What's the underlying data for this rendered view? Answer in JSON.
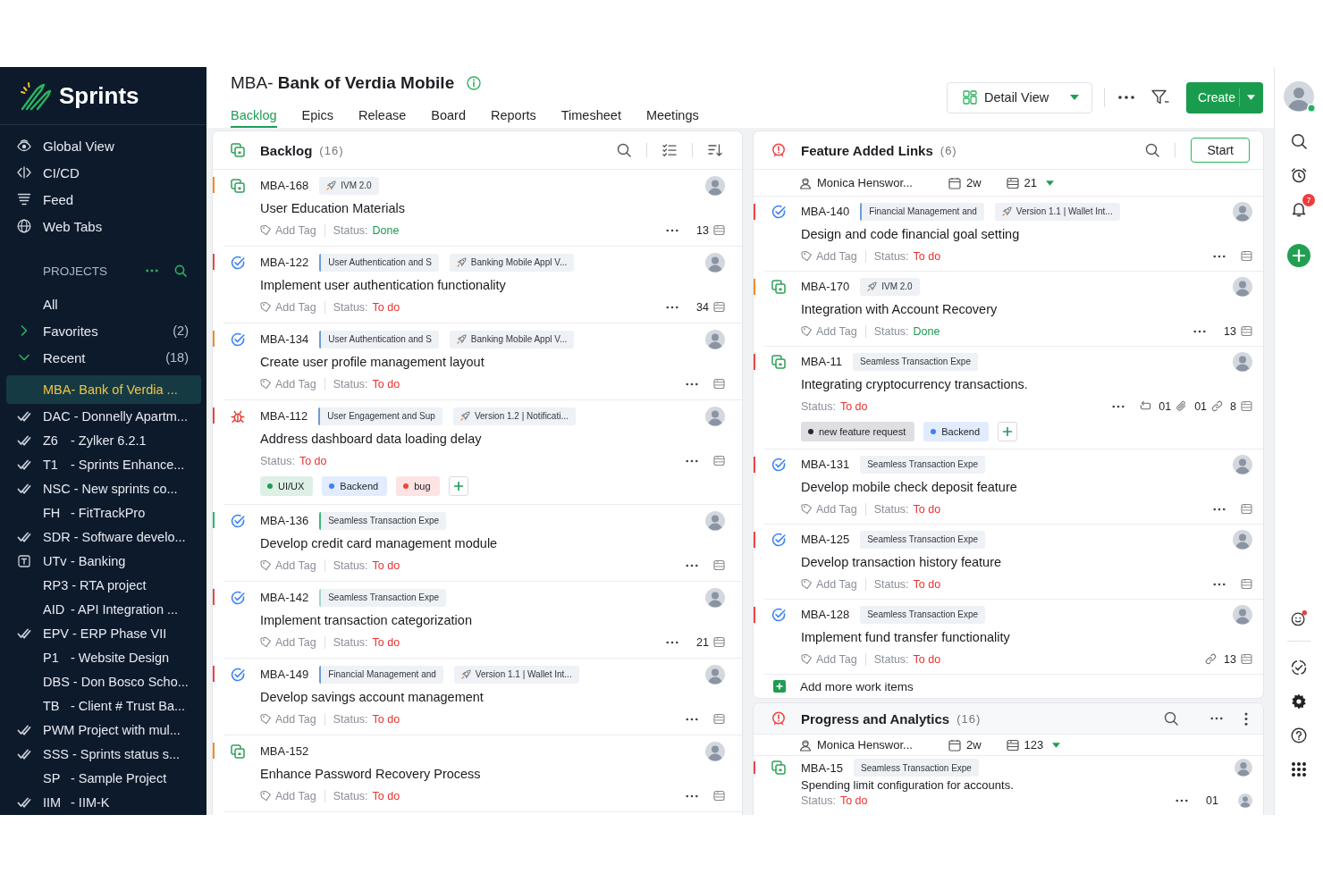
{
  "sidebar": {
    "logo": "Sprints",
    "nav": [
      {
        "label": "Global View"
      },
      {
        "label": "CI/CD"
      },
      {
        "label": "Feed"
      },
      {
        "label": "Web Tabs"
      }
    ],
    "projects": {
      "heading": "PROJECTS",
      "all": "All",
      "groups": [
        {
          "label": "Favorites",
          "count": "(2)",
          "expanded": false
        },
        {
          "label": "Recent",
          "count": "(18)",
          "expanded": true,
          "children": [
            {
              "name": "MBA- Bank of Verdia ...",
              "kind": "plain",
              "selected": true
            },
            {
              "code": "DAC",
              "name": "- Donnelly Apartm...",
              "kind": "check",
              "selected": false
            },
            {
              "code": "Z6",
              "name": "- Zylker 6.2.1",
              "kind": "check",
              "selected": false
            },
            {
              "code": "T1",
              "name": "- Sprints Enhance...",
              "kind": "check",
              "selected": false
            },
            {
              "code": "NSC",
              "name": "- New sprints co...",
              "kind": "check",
              "selected": false
            },
            {
              "code": "FH",
              "name": "- FitTrackPro",
              "kind": "plain",
              "selected": false
            },
            {
              "code": "SDR",
              "name": "- Software develo...",
              "kind": "check",
              "selected": false
            },
            {
              "code": "UTv",
              "name": "- Banking",
              "kind": "text",
              "selected": false
            },
            {
              "code": "RP3",
              "name": "- RTA project",
              "kind": "plain",
              "selected": false
            },
            {
              "code": "AID",
              "name": "- API Integration ...",
              "kind": "plain",
              "selected": false
            },
            {
              "code": "EPV",
              "name": "- ERP Phase VII",
              "kind": "check",
              "selected": false
            },
            {
              "code": "P1",
              "name": "- Website Design",
              "kind": "plain",
              "selected": false
            },
            {
              "code": "DBS",
              "name": "- Don Bosco Scho...",
              "kind": "plain",
              "selected": false
            },
            {
              "code": "TB",
              "name": "- Client # Trust Ba...",
              "kind": "plain",
              "selected": false
            },
            {
              "code": "PWM",
              "name": "Project with mul...",
              "kind": "check",
              "selected": false
            },
            {
              "code": "SSS",
              "name": "- Sprints status s...",
              "kind": "check",
              "selected": false
            },
            {
              "code": "SP",
              "name": "- Sample Project",
              "kind": "plain",
              "selected": false
            },
            {
              "code": "IIM",
              "name": "- IIM-K",
              "kind": "check",
              "selected": false
            }
          ]
        }
      ]
    }
  },
  "header": {
    "title": "MBA- **Bank of Verdia Mobile**",
    "tabs": [
      {
        "label": "Backlog",
        "selected": true
      },
      {
        "label": "Epics",
        "selected": false
      },
      {
        "label": "Release",
        "selected": false
      },
      {
        "label": "Board",
        "selected": false
      },
      {
        "label": "Reports",
        "selected": false
      },
      {
        "label": "Timesheet",
        "selected": false
      },
      {
        "label": "Meetings",
        "selected": false
      }
    ],
    "view_button": "Detail View",
    "create_button": "Create"
  },
  "rail": {
    "notifications": "7"
  },
  "backlog": {
    "title": "Backlog",
    "count": "(16)",
    "items": [
      {
        "id": "MBA-168",
        "kind": "story",
        "color": "#f28c28",
        "chips": [
          {
            "kind": "release",
            "label": "IVM 2.0"
          }
        ],
        "title": "User Education Materials",
        "add_tag": "Add Tag",
        "status_label": "Status:",
        "status": "Done",
        "done": true,
        "meta": [
          {
            "kind": "more"
          },
          {
            "kind": "text",
            "text": "13"
          },
          {
            "kind": "points"
          }
        ]
      },
      {
        "id": "MBA-122",
        "kind": "task",
        "color": "#ef4444",
        "chips": [
          {
            "kind": "epic",
            "label": "User Authentication and S",
            "color": "#6b9bd8"
          },
          {
            "kind": "release",
            "label": "Banking Mobile Appl V..."
          }
        ],
        "title": "Implement user authentication functionality",
        "add_tag": "Add Tag",
        "status_label": "Status:",
        "status": "To do",
        "done": false,
        "meta": [
          {
            "kind": "more"
          },
          {
            "kind": "text",
            "text": "34"
          },
          {
            "kind": "points"
          }
        ]
      },
      {
        "id": "MBA-134",
        "kind": "task",
        "color": "#f28c28",
        "chips": [
          {
            "kind": "epic",
            "label": "User Authentication and S",
            "color": "#6b9bd8"
          },
          {
            "kind": "release",
            "label": "Banking Mobile Appl V..."
          }
        ],
        "title": "Create user profile management layout",
        "add_tag": "Add Tag",
        "status_label": "Status:",
        "status": "To do",
        "done": false,
        "meta": [
          {
            "kind": "more"
          },
          {
            "kind": "points"
          }
        ]
      },
      {
        "id": "MBA-112",
        "kind": "bug",
        "color": "#ef4444",
        "chips": [
          {
            "kind": "epic",
            "label": "User Engagement and Sup",
            "color": "#6b9bd8"
          },
          {
            "kind": "release",
            "label": "Version 1.2 | Notificati..."
          }
        ],
        "title": "Address dashboard data loading delay",
        "status_label": "Status:",
        "status": "To do",
        "done": false,
        "meta": [
          {
            "kind": "more"
          },
          {
            "kind": "points"
          }
        ],
        "tags": [
          {
            "label": "UI/UX",
            "color": "#1f9d55"
          },
          {
            "label": "Backend",
            "color": "#3b82f6"
          },
          {
            "label": "bug",
            "color": "#ef4444"
          }
        ]
      },
      {
        "id": "MBA-136",
        "kind": "task",
        "color": "#2eb872",
        "chips": [
          {
            "kind": "epic",
            "label": "Seamless Transaction Expe",
            "color": "#3cb878"
          }
        ],
        "title": "Develop credit card management module",
        "add_tag": "Add Tag",
        "status_label": "Status:",
        "status": "To do",
        "done": false,
        "meta": [
          {
            "kind": "more"
          },
          {
            "kind": "points"
          }
        ]
      },
      {
        "id": "MBA-142",
        "kind": "task",
        "color": "#ef4444",
        "chips": [
          {
            "kind": "epic",
            "label": "Seamless Transaction Expe",
            "color": "#9fd6cc"
          }
        ],
        "title": "Implement transaction categorization",
        "add_tag": "Add Tag",
        "status_label": "Status:",
        "status": "To do",
        "done": false,
        "meta": [
          {
            "kind": "more"
          },
          {
            "kind": "text",
            "text": "21"
          },
          {
            "kind": "points"
          }
        ]
      },
      {
        "id": "MBA-149",
        "kind": "task",
        "color": "#ef4444",
        "chips": [
          {
            "kind": "epic",
            "label": "Financial Management and",
            "color": "#6b9bd8"
          },
          {
            "kind": "release",
            "label": "Version 1.1 | Wallet Int..."
          }
        ],
        "title": "Develop savings account management",
        "add_tag": "Add Tag",
        "status_label": "Status:",
        "status": "To do",
        "done": false,
        "meta": [
          {
            "kind": "more"
          },
          {
            "kind": "points"
          }
        ]
      },
      {
        "id": "MBA-152",
        "kind": "story",
        "color": "#f28c28",
        "title": "Enhance Password Recovery Process",
        "add_tag": "Add Tag",
        "status_label": "Status:",
        "status": "To do",
        "done": false,
        "meta": [
          {
            "kind": "more"
          },
          {
            "kind": "points"
          }
        ]
      }
    ]
  },
  "sprints": [
    {
      "title": "Feature Added Links",
      "count": "(6)",
      "action": "Start",
      "owner": "Monica Henswor...",
      "duration": "2w",
      "points": "21",
      "compact": false,
      "items": [
        {
          "id": "MBA-140",
          "kind": "task",
          "color": "#ef4444",
          "chips": [
            {
              "kind": "epic",
              "label": "Financial Management and",
              "color": "#6b9bd8"
            },
            {
              "kind": "release",
              "label": "Version 1.1 | Wallet Int..."
            }
          ],
          "title": "Design and code financial goal setting",
          "add_tag": "Add Tag",
          "status_label": "Status:",
          "status": "To do",
          "done": false,
          "meta": [
            {
              "kind": "more"
            },
            {
              "kind": "points"
            }
          ]
        },
        {
          "id": "MBA-170",
          "kind": "story",
          "color": "#f28c28",
          "chips": [
            {
              "kind": "release",
              "label": "IVM 2.0"
            }
          ],
          "title": "Integration with Account Recovery",
          "add_tag": "Add Tag",
          "status_label": "Status:",
          "status": "Done",
          "done": true,
          "meta": [
            {
              "kind": "more"
            },
            {
              "kind": "text",
              "text": "13"
            },
            {
              "kind": "points"
            }
          ]
        },
        {
          "id": "MBA-11",
          "kind": "story",
          "color": "#ef4444",
          "chips": [
            {
              "kind": "epic",
              "label": "Seamless Transaction Expe"
            }
          ],
          "title": "Integrating cryptocurrency transactions.",
          "status_label": "Status:",
          "status": "To do",
          "done": false,
          "meta": [
            {
              "kind": "more"
            },
            {
              "kind": "subtasks"
            },
            {
              "kind": "text",
              "text": "01"
            },
            {
              "kind": "attachment"
            },
            {
              "kind": "text",
              "text": "01"
            },
            {
              "kind": "link"
            },
            {
              "kind": "text",
              "text": "8"
            },
            {
              "kind": "points"
            }
          ],
          "tags": [
            {
              "label": "new feature request",
              "color": "#2a2438"
            },
            {
              "label": "Backend",
              "color": "#3b82f6"
            }
          ]
        },
        {
          "id": "MBA-131",
          "kind": "task",
          "color": "#ef4444",
          "chips": [
            {
              "kind": "epic",
              "label": "Seamless Transaction Expe"
            }
          ],
          "title": "Develop mobile check deposit feature",
          "add_tag": "Add Tag",
          "status_label": "Status:",
          "status": "To do",
          "done": false,
          "meta": [
            {
              "kind": "more"
            },
            {
              "kind": "points"
            }
          ]
        },
        {
          "id": "MBA-125",
          "kind": "task",
          "color": "#ef4444",
          "chips": [
            {
              "kind": "epic",
              "label": "Seamless Transaction Expe"
            }
          ],
          "title": "Develop transaction history feature",
          "add_tag": "Add Tag",
          "status_label": "Status:",
          "status": "To do",
          "done": false,
          "meta": [
            {
              "kind": "more"
            },
            {
              "kind": "points"
            }
          ]
        },
        {
          "id": "MBA-128",
          "kind": "task",
          "color": "#ef4444",
          "chips": [
            {
              "kind": "epic",
              "label": "Seamless Transaction Expe"
            }
          ],
          "title": "Implement fund transfer functionality",
          "add_tag": "Add Tag",
          "status_label": "Status:",
          "status": "To do",
          "done": false,
          "meta": [
            {
              "kind": "link"
            },
            {
              "kind": "text",
              "text": "13"
            },
            {
              "kind": "points"
            }
          ]
        }
      ],
      "add_label": "Add more work items"
    },
    {
      "title": "Progress and Analytics",
      "count": "(16)",
      "owner": "Monica Henswor...",
      "duration": "2w",
      "points": "123",
      "compact": true,
      "items": [
        {
          "id": "MBA-15",
          "kind": "story",
          "color": "#ef4444",
          "chips": [
            {
              "kind": "epic",
              "label": "Seamless Transaction Expe"
            }
          ],
          "title": "Spending limit configuration for accounts.",
          "status_label": "Status:",
          "status": "To do",
          "done": false,
          "meta": [
            {
              "kind": "more"
            },
            {
              "kind": "text",
              "text": "01"
            },
            {
              "kind": "avatar"
            }
          ]
        }
      ]
    }
  ]
}
